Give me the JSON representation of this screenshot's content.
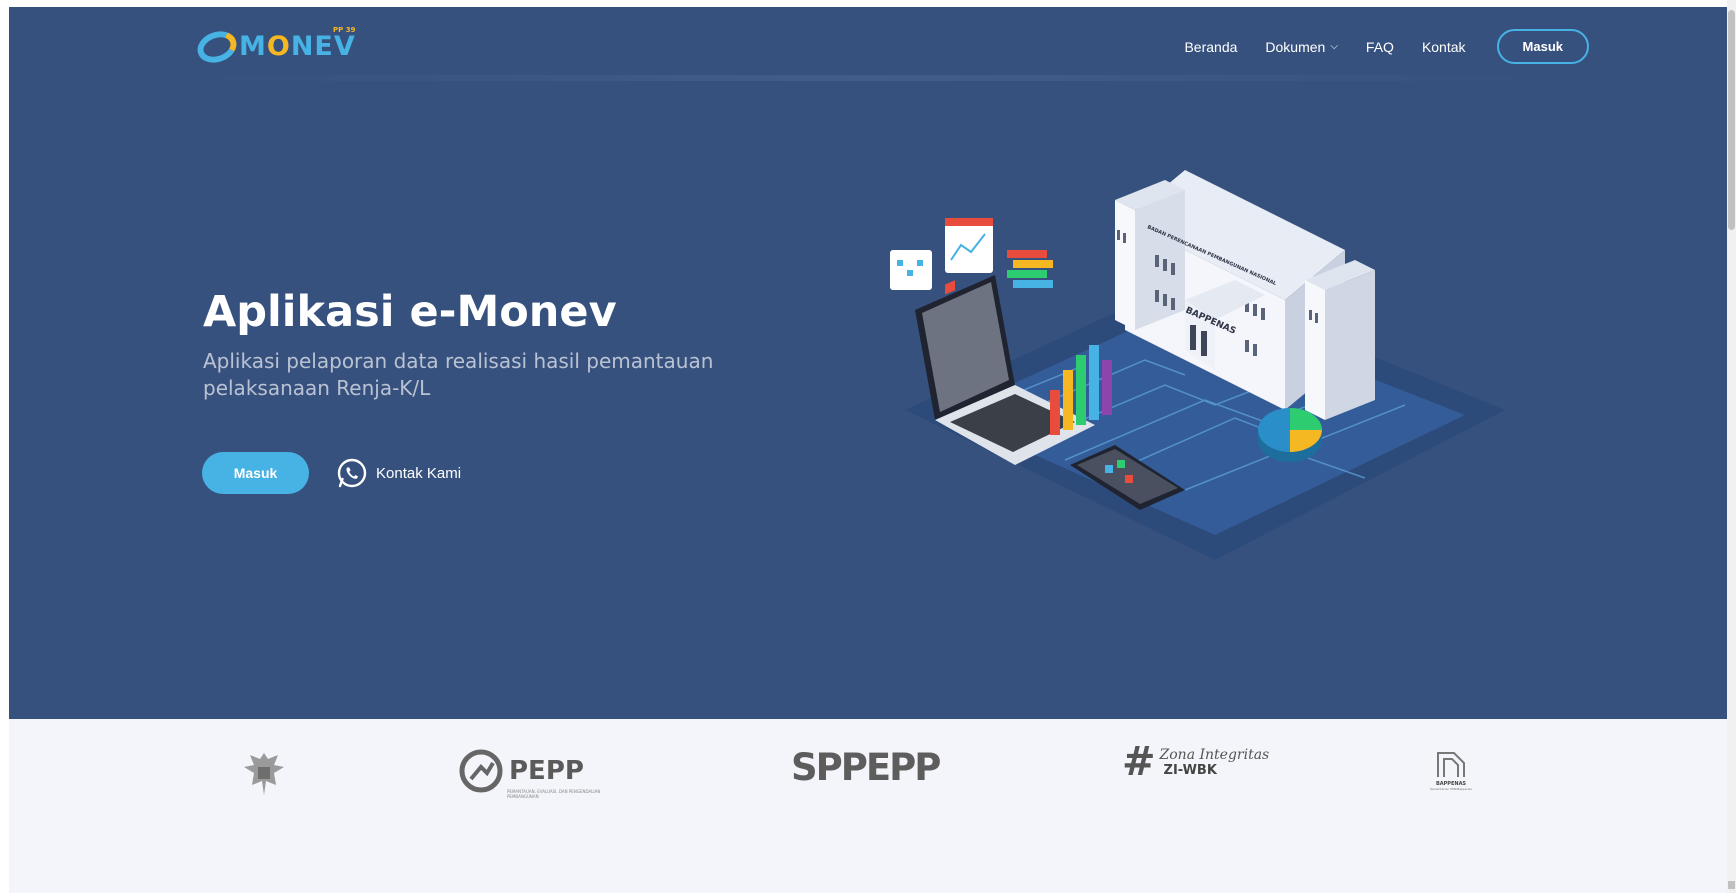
{
  "brand": {
    "logo_text_e": "M",
    "logo_text_o": "O",
    "logo_text_rest": "NEV",
    "logo_sup": "PP 39"
  },
  "nav": {
    "items": [
      {
        "label": "Beranda"
      },
      {
        "label": "Dokumen"
      },
      {
        "label": "FAQ"
      },
      {
        "label": "Kontak"
      }
    ],
    "login_label": "Masuk"
  },
  "hero": {
    "title": "Aplikasi e-Monev",
    "subtitle": "Aplikasi pelaporan data realisasi hasil pemantauan pelaksanaan Renja-K/L",
    "primary_button": "Masuk",
    "contact_button": "Kontak Kami",
    "building_sign": "BAPPENAS",
    "building_banner": "BADAN PERENCANAAN PEMBANGUNAN NASIONAL"
  },
  "partners": {
    "pepp_name": "PEPP",
    "pepp_small": "PEMANTAUAN, EVALUASI, DAN PENGENDALIAN PEMBANGUNAN",
    "sppepp": "SPPEPP",
    "zona_line1": "Zona Integritas",
    "zona_line2": "ZI-WBK",
    "bappenas": "BAPPENAS",
    "bappenas_sub": "Kementerian PPN/Bappenas"
  },
  "colors": {
    "hero_bg": "#37517e",
    "accent": "#47b2e4",
    "partners_bg": "#f3f5fa"
  }
}
